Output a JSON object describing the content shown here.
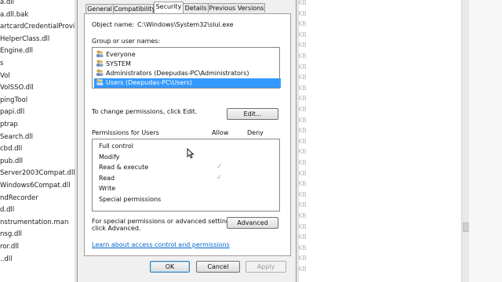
{
  "background": {
    "file_list": [
      "a.dll",
      "a.dll.bak",
      "artcardCredentialProvider",
      "HelperClass.dll",
      "Engine.dll",
      "s",
      "Vol",
      "VolSSO.dll",
      "pingTool",
      "papi.dll",
      "ptrap",
      "Search.dll",
      "cbd.dll",
      "pub.dll",
      "Server2003Compat.dll",
      "Windows6Compat.dll",
      "ndRecorder",
      "d.dll",
      "nstrumentation.man",
      "nsg.dll",
      "ror.dll",
      "..dll"
    ],
    "size_unit": "KB",
    "size_rows": 26
  },
  "dialog": {
    "tabs": [
      {
        "label": "General"
      },
      {
        "label": "Compatibility"
      },
      {
        "label": "Security"
      },
      {
        "label": "Details"
      },
      {
        "label": "Previous Versions"
      }
    ],
    "active_tab": "Security",
    "object_name_label": "Object name:",
    "object_name_value": "C:\\Windows\\System32\\slui.exe",
    "group_names_label": "Group or user names:",
    "groups": [
      {
        "name": "Everyone"
      },
      {
        "name": "SYSTEM"
      },
      {
        "name": "Administrators (Deepudas-PC\\Administrators)"
      },
      {
        "name": "Users (Deepudas-PC\\Users)"
      }
    ],
    "selected_group": "Users (Deepudas-PC\\Users)",
    "change_permissions_text": "To change permissions, click Edit.",
    "edit_button": "Edit...",
    "permissions_for_label": "Permissions for Users",
    "allow_header": "Allow",
    "deny_header": "Deny",
    "permissions": [
      {
        "name": "Full control",
        "allow": false,
        "deny": false
      },
      {
        "name": "Modify",
        "allow": false,
        "deny": false
      },
      {
        "name": "Read & execute",
        "allow": true,
        "deny": false
      },
      {
        "name": "Read",
        "allow": true,
        "deny": false
      },
      {
        "name": "Write",
        "allow": false,
        "deny": false
      },
      {
        "name": "Special permissions",
        "allow": false,
        "deny": false
      }
    ],
    "special_text_line1": "For special permissions or advanced settings,",
    "special_text_line2": "click Advanced.",
    "advanced_button": "Advanced",
    "learn_link": "Learn about access control and permissions",
    "ok_button": "OK",
    "cancel_button": "Cancel",
    "apply_button": "Apply",
    "check_glyph": "✓",
    "colors": {
      "selection": "#3399ff",
      "link": "#0066cc",
      "disabled_check": "#a8a8a8"
    }
  }
}
